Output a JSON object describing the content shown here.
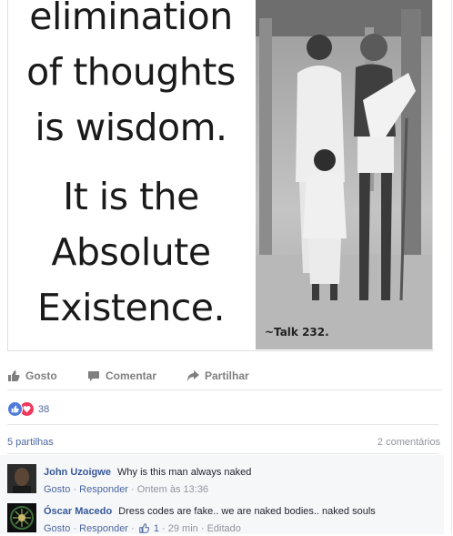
{
  "post": {
    "image": {
      "quote_lines": [
        "elimination",
        "of thoughts",
        "is wisdom.",
        "It is the",
        "Absolute",
        "Existence."
      ],
      "caption": "~Talk 232."
    },
    "actions": {
      "like": "Gosto",
      "comment": "Comentar",
      "share": "Partilhar"
    },
    "reactions": {
      "icons": [
        "like-icon",
        "love-icon"
      ],
      "count": "38"
    },
    "shares": "5 partilhas",
    "comments_count": "2 comentários",
    "comments": [
      {
        "author": "John Uzoigwe",
        "text": "Why is this man always naked",
        "like_label": "Gosto",
        "reply_label": "Responder",
        "time": "Ontem às 13:36"
      },
      {
        "author": "Óscar Macedo",
        "text": "Dress codes are fake.. we are naked bodies.. naked souls",
        "like_label": "Gosto",
        "reply_label": "Responder",
        "likes": "1",
        "time": "29 min",
        "edited": "Editado"
      }
    ]
  },
  "colors": {
    "link": "#365899",
    "muted": "#90949c",
    "like_blue": "#4f7cd8",
    "love_red": "#f0385c"
  }
}
